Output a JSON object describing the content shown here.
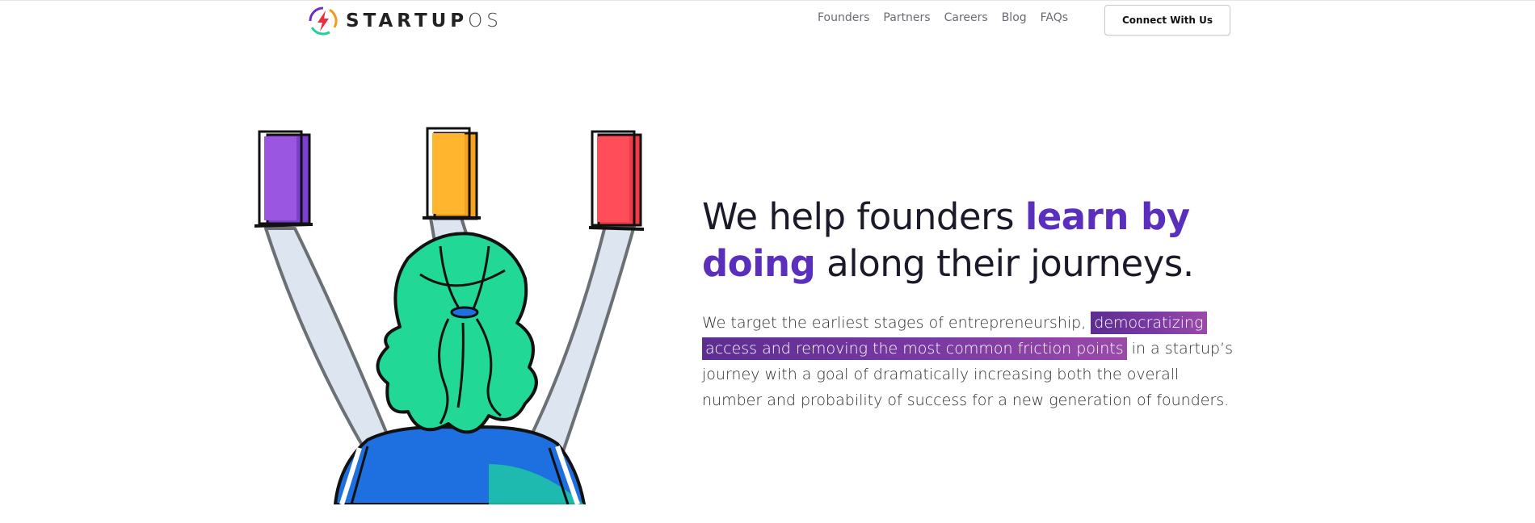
{
  "brand": {
    "name_part1": "STARTUP",
    "name_part2": "OS",
    "logo_icon": "lightning-bolt-logo-icon",
    "colors": {
      "purple": "#6a2fc6",
      "orange": "#f59a1c",
      "red": "#ee2e3f",
      "green": "#1fd398"
    }
  },
  "nav": {
    "links": [
      "Founders",
      "Partners",
      "Careers",
      "Blog",
      "FAQs"
    ],
    "cta_label": "Connect With Us"
  },
  "hero": {
    "title_part1": "We help founders ",
    "title_highlight1": "learn by",
    "title_highlight2": "doing",
    "title_part2": " along their journeys.",
    "body_part1": "We target the earliest stages of entrepreneurship, ",
    "body_highlight": "democratizing access and removing the most common friction points",
    "body_part2": " in a startup’s journey with a goal of dramatically increasing both the overall number and probability of success for a new generation of founders.",
    "highlight_color": "#5b2fbd"
  },
  "illustration": {
    "doors": [
      {
        "color": "#7b3fd1"
      },
      {
        "color": "#f7a21c"
      },
      {
        "color": "#f23a48"
      }
    ],
    "hair_color": "#22d896",
    "shirt_color": "#1e6fe0"
  }
}
